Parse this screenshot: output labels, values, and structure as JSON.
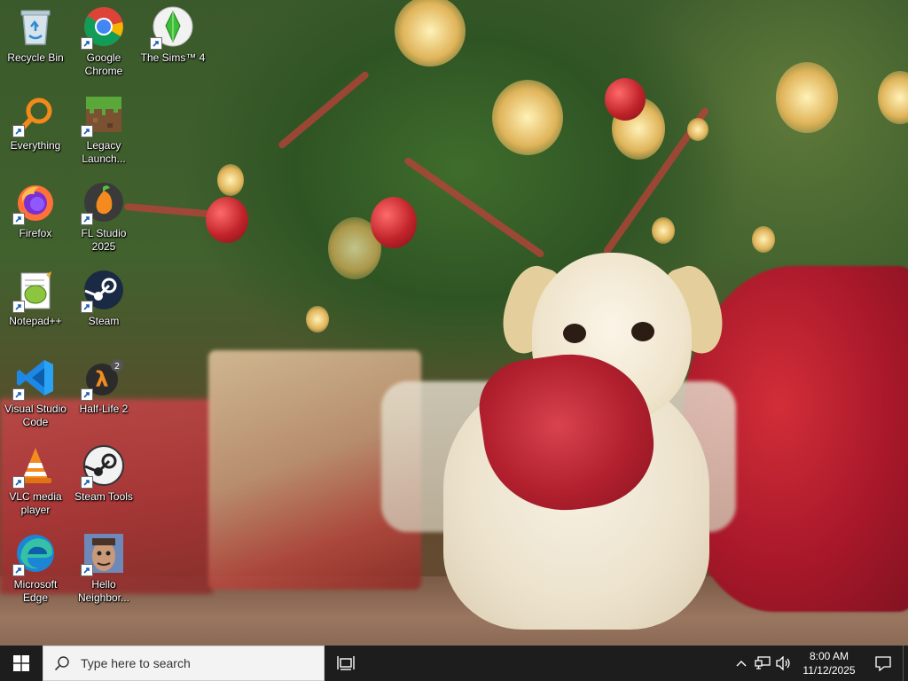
{
  "desktop": {
    "icons": [
      {
        "label": "Recycle Bin",
        "icon": "recycle-bin-icon"
      },
      {
        "label": "Google Chrome",
        "icon": "chrome-icon"
      },
      {
        "label": "The Sims™ 4",
        "icon": "sims4-icon"
      },
      {
        "label": "Everything",
        "icon": "everything-search-icon"
      },
      {
        "label": "Legacy Launch...",
        "icon": "minecraft-grass-block-icon"
      },
      {
        "label": "Firefox",
        "icon": "firefox-icon"
      },
      {
        "label": "FL Studio 2025",
        "icon": "fl-studio-icon"
      },
      {
        "label": "Notepad++",
        "icon": "notepadpp-icon"
      },
      {
        "label": "Steam",
        "icon": "steam-icon"
      },
      {
        "label": "Visual Studio Code",
        "icon": "vscode-icon"
      },
      {
        "label": "Half-Life 2",
        "icon": "half-life-2-icon"
      },
      {
        "label": "VLC media player",
        "icon": "vlc-icon"
      },
      {
        "label": "Steam Tools",
        "icon": "steam-tools-icon"
      },
      {
        "label": "Microsoft Edge",
        "icon": "edge-icon"
      },
      {
        "label": "Hello Neighbor...",
        "icon": "hello-neighbor-icon"
      }
    ]
  },
  "taskbar": {
    "search_placeholder": "Type here to search",
    "clock_time": "8:00 AM",
    "clock_date": "11/12/2025"
  },
  "colors": {
    "taskbar_bg": "#1c1c1c",
    "search_bg": "#f3f3f3",
    "icon_label": "#ffffff"
  }
}
